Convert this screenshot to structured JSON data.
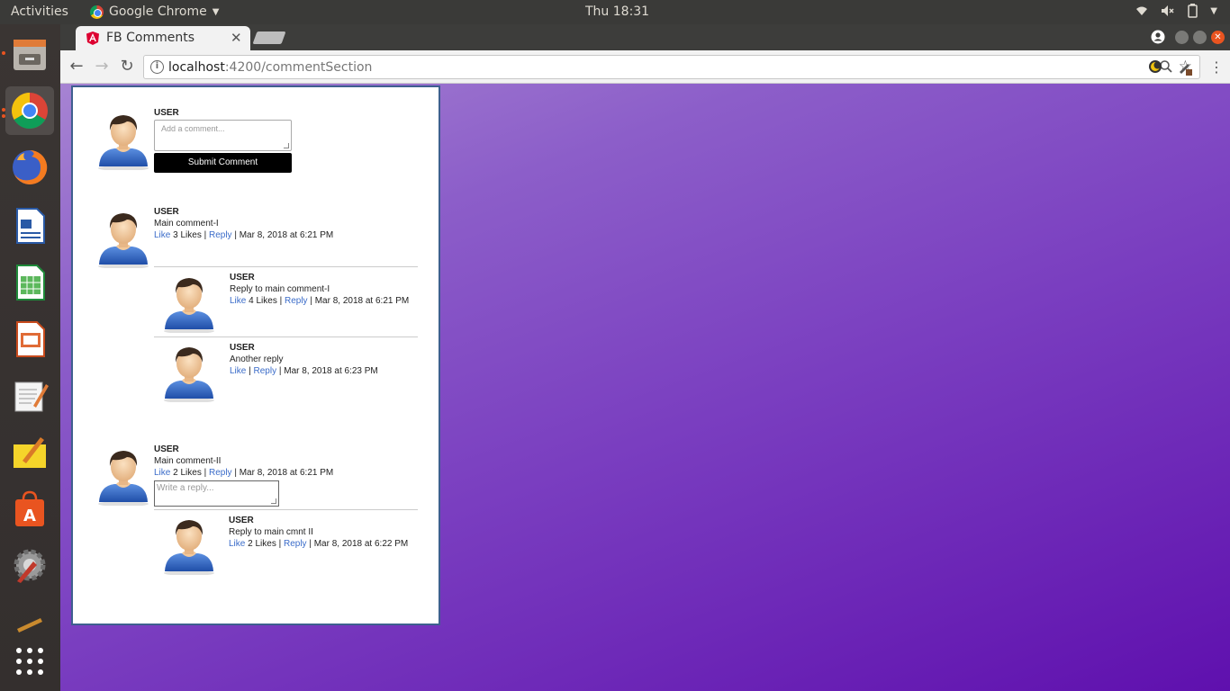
{
  "topbar": {
    "activities": "Activities",
    "app_name": "Google Chrome",
    "clock": "Thu 18:31"
  },
  "dock": {
    "items": [
      "files-icon",
      "chrome-icon",
      "firefox-icon",
      "writer-icon",
      "calc-icon",
      "impress-icon",
      "text-editor-icon",
      "notes-icon",
      "software-center-icon",
      "settings-icon",
      "trash-icon",
      "app-grid-icon"
    ]
  },
  "browser": {
    "tab_title": "FB Comments",
    "url_host": "localhost",
    "url_path": ":4200/commentSection"
  },
  "compose": {
    "user": "USER",
    "placeholder": "Add a comment...",
    "submit_label": "Submit Comment"
  },
  "comments": [
    {
      "user": "USER",
      "text": "Main comment-I",
      "like_label": "Like",
      "likes_text": "3 Likes",
      "reply_label": "Reply",
      "timestamp": "Mar 8, 2018 at 6:21 PM",
      "replies": [
        {
          "user": "USER",
          "text": "Reply to main comment-I",
          "like_label": "Like",
          "likes_text": "4 Likes",
          "reply_label": "Reply",
          "timestamp": "Mar 8, 2018 at 6:21 PM"
        },
        {
          "user": "USER",
          "text": "Another reply",
          "like_label": "Like",
          "likes_text": "",
          "reply_label": "Reply",
          "timestamp": "Mar 8, 2018 at 6:23 PM"
        }
      ]
    },
    {
      "user": "USER",
      "text": "Main comment-II",
      "like_label": "Like",
      "likes_text": "2 Likes",
      "reply_label": "Reply",
      "timestamp": "Mar 8, 2018 at 6:21 PM",
      "reply_placeholder": "Write a reply...",
      "replies": [
        {
          "user": "USER",
          "text": "Reply to main cmnt II",
          "like_label": "Like",
          "likes_text": "2 Likes",
          "reply_label": "Reply",
          "timestamp": "Mar 8, 2018 at 6:22 PM"
        }
      ]
    }
  ]
}
